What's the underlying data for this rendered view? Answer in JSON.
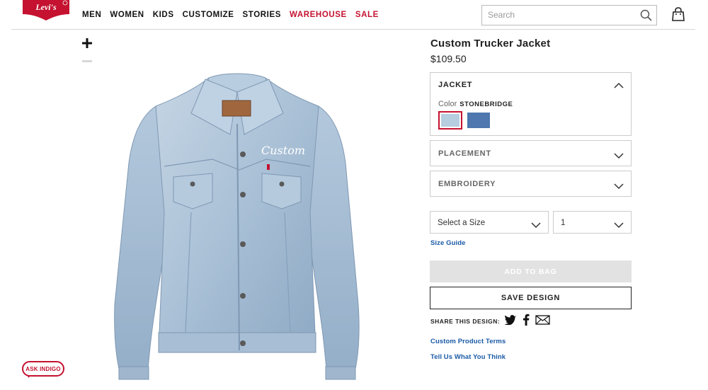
{
  "header": {
    "logo_text": "Levi's",
    "nav": [
      {
        "label": "MEN",
        "accent": false
      },
      {
        "label": "WOMEN",
        "accent": false
      },
      {
        "label": "KIDS",
        "accent": false
      },
      {
        "label": "CUSTOMIZE",
        "accent": false
      },
      {
        "label": "STORIES",
        "accent": false
      },
      {
        "label": "WAREHOUSE",
        "accent": true
      },
      {
        "label": "SALE",
        "accent": true
      }
    ],
    "search_placeholder": "Search",
    "icons": {
      "search": "search-icon",
      "bag": "shopping-bag-icon"
    }
  },
  "gallery": {
    "zoom_icon": "plus-icon",
    "embroidery_text": "Custom"
  },
  "chat": {
    "label": "ASK INDIGO"
  },
  "product": {
    "title": "Custom Trucker Jacket",
    "price": "$109.50"
  },
  "options": {
    "jacket": {
      "heading": "JACKET",
      "color_label": "Color",
      "color_value": "STONEBRIDGE",
      "swatches": [
        {
          "name": "Stonebridge",
          "color": "#b7cde0",
          "selected": true
        },
        {
          "name": "Dark wash",
          "color": "#4d77ae",
          "selected": false
        }
      ]
    },
    "placement": {
      "label": "PLACEMENT"
    },
    "embroidery": {
      "label": "EMBROIDERY"
    },
    "size_select": {
      "label": "Select a Size"
    },
    "qty_select": {
      "label": "1"
    },
    "size_guide": "Size Guide"
  },
  "actions": {
    "add_to_bag": "ADD TO BAG",
    "save_design": "SAVE DESIGN"
  },
  "share": {
    "label": "SHARE THIS DESIGN:",
    "icons": [
      "twitter-icon",
      "facebook-icon",
      "email-icon"
    ]
  },
  "links": {
    "terms": "Custom Product Terms",
    "feedback": "Tell Us What You Think"
  },
  "colors": {
    "brand_red": "#c41230",
    "link_blue": "#1a5aa6",
    "disabled_gray": "#e2e2e2"
  }
}
